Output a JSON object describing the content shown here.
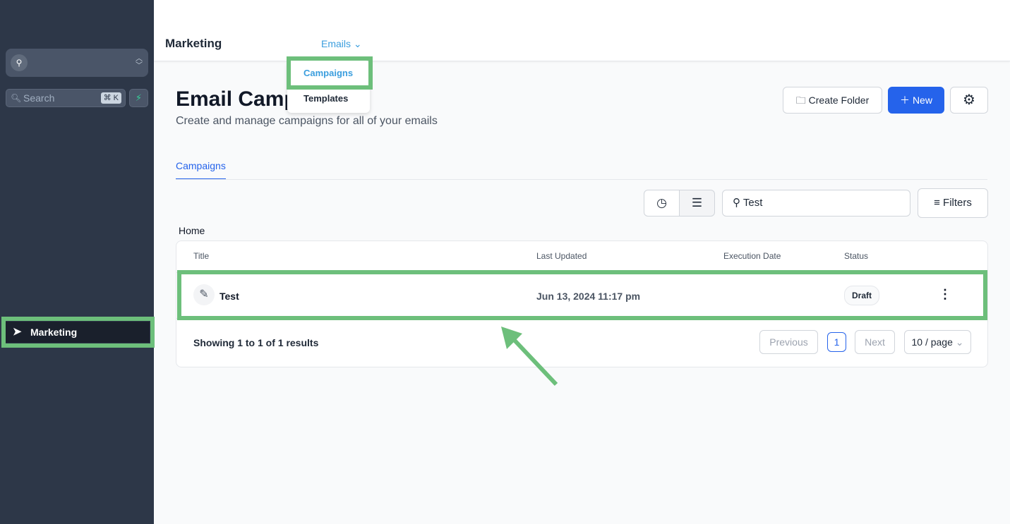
{
  "sidebar": {
    "search_placeholder": "Search",
    "shortcut": "⌘ K",
    "nav": [
      {
        "label": "Marketing",
        "icon": "send-icon"
      }
    ]
  },
  "header": {
    "title": "Marketing",
    "menu": "Emails",
    "dropdown": [
      "Campaigns",
      "Templates"
    ]
  },
  "page": {
    "title": "Email Campaigns",
    "subtitle": "Create and manage campaigns for all of your emails",
    "create_folder": "Create Folder",
    "new": "New",
    "tab": "Campaigns",
    "search_value": "Test",
    "filters": "Filters",
    "breadcrumb": "Home"
  },
  "table": {
    "columns": [
      "Title",
      "Last Updated",
      "Execution Date",
      "Status"
    ],
    "rows": [
      {
        "title": "Test",
        "updated": "Jun 13, 2024 11:17 pm",
        "execution": "",
        "status": "Draft"
      }
    ],
    "summary": "Showing 1 to 1 of 1 results",
    "prev": "Previous",
    "page": "1",
    "next": "Next",
    "per_page": "10 / page"
  },
  "colors": {
    "accent": "#2563eb",
    "highlight": "#6dbf7b",
    "sidebar": "#2d3748"
  }
}
